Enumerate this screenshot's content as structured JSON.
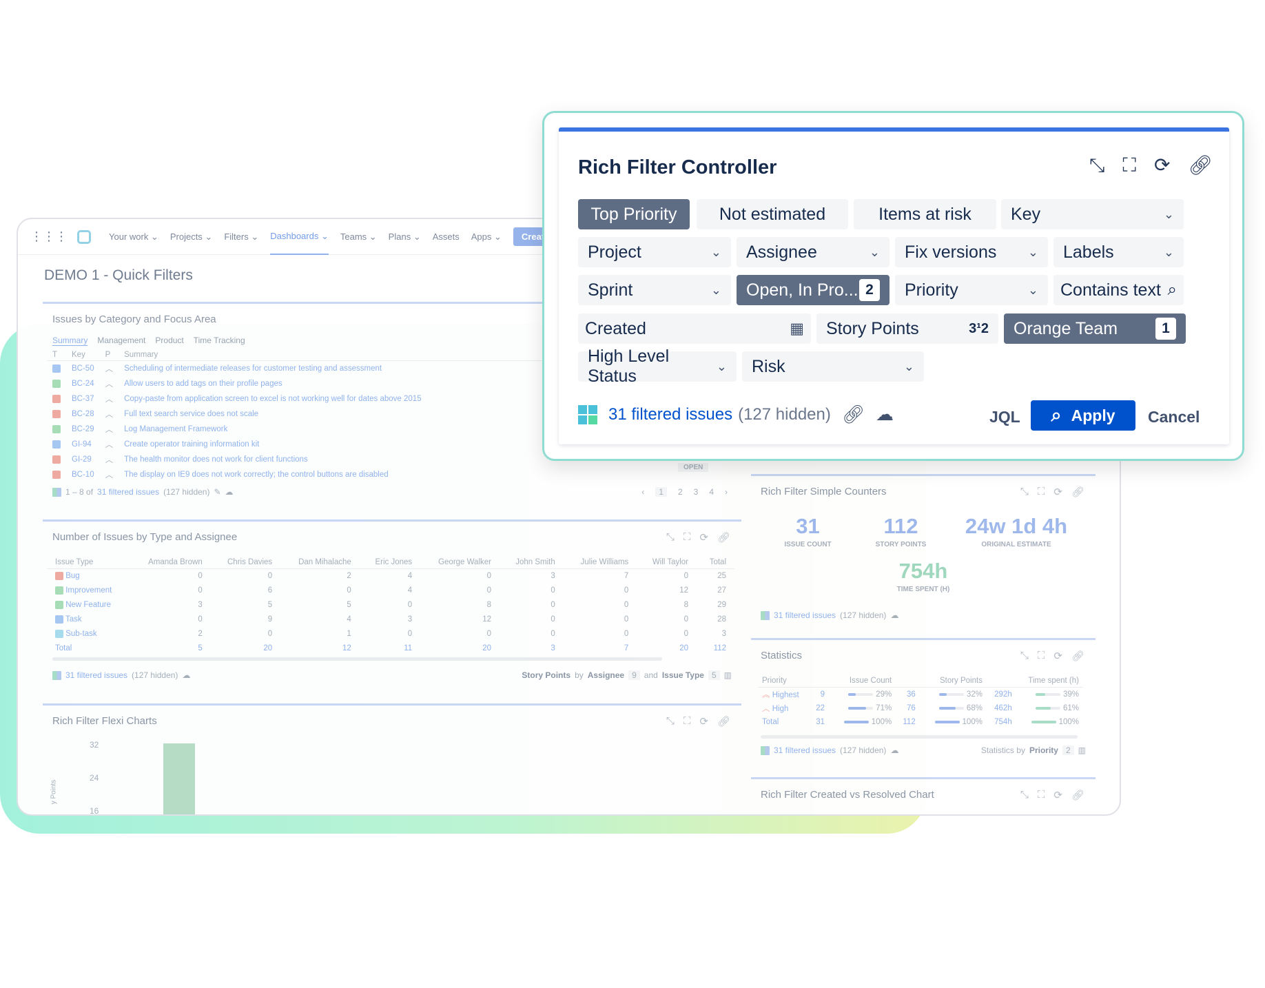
{
  "nav": {
    "items": [
      "Your work",
      "Projects",
      "Filters",
      "Dashboards",
      "Teams",
      "Plans",
      "Assets",
      "Apps"
    ],
    "active": "Dashboards",
    "create_label": "Create"
  },
  "dashboard": {
    "title": "DEMO 1 - Quick Filters"
  },
  "issues_gadget": {
    "title": "Issues by Category and Focus Area",
    "tabs": [
      "Summary",
      "Management",
      "Product",
      "Time Tracking"
    ],
    "columns": [
      "T",
      "Key",
      "P",
      "Summary"
    ],
    "rows": [
      {
        "type": "blue",
        "key": "BC-50",
        "summary": "Scheduling of intermediate releases for customer testing and assessment"
      },
      {
        "type": "green",
        "key": "BC-24",
        "summary": "Allow users to add tags on their profile pages"
      },
      {
        "type": "red",
        "key": "BC-37",
        "summary": "Copy-paste from application screen to excel is not working well for dates above 2015"
      },
      {
        "type": "red",
        "key": "BC-28",
        "summary": "Full text search service does not scale"
      },
      {
        "type": "green",
        "key": "BC-29",
        "summary": "Log Management Framework"
      },
      {
        "type": "blue",
        "key": "GI-94",
        "summary": "Create operator training information kit"
      },
      {
        "type": "red",
        "key": "GI-29",
        "summary": "The health monitor does not work for client functions"
      },
      {
        "type": "red",
        "key": "BC-10",
        "summary": "The display on IE9 does not work correctly; the control buttons are disabled"
      }
    ],
    "status_badge": "OPEN",
    "footer_range": "1 – 8 of",
    "footer_link": "31 filtered issues",
    "footer_hidden": "(127 hidden)",
    "pages": [
      "1",
      "2",
      "3",
      "4"
    ]
  },
  "type_gadget": {
    "title": "Number of Issues by Type and Assignee",
    "columns": [
      "Issue Type",
      "Amanda Brown",
      "Chris Davies",
      "Dan Mihalache",
      "Eric Jones",
      "George Walker",
      "John Smith",
      "Julie Williams",
      "Will Taylor",
      "Total"
    ],
    "rows": [
      {
        "type": "red",
        "name": "Bug",
        "values": [
          "0",
          "0",
          "2",
          "4",
          "0",
          "3",
          "7",
          "0",
          "25"
        ]
      },
      {
        "type": "green",
        "name": "Improvement",
        "values": [
          "0",
          "6",
          "0",
          "4",
          "0",
          "0",
          "0",
          "12",
          "27"
        ]
      },
      {
        "type": "green",
        "name": "New Feature",
        "values": [
          "3",
          "5",
          "5",
          "0",
          "8",
          "0",
          "0",
          "8",
          "29"
        ]
      },
      {
        "type": "blue",
        "name": "Task",
        "values": [
          "0",
          "9",
          "4",
          "3",
          "12",
          "0",
          "0",
          "0",
          "28"
        ]
      },
      {
        "type": "cyan",
        "name": "Sub-task",
        "values": [
          "2",
          "0",
          "1",
          "0",
          "0",
          "0",
          "0",
          "0",
          "3"
        ]
      }
    ],
    "total": {
      "name": "Total",
      "values": [
        "5",
        "20",
        "12",
        "11",
        "20",
        "3",
        "7",
        "20",
        "112"
      ]
    },
    "footer_link": "31 filtered issues",
    "footer_hidden": "(127 hidden)",
    "summary": {
      "metric": "Story Points",
      "by": "by",
      "dim1": "Assignee",
      "n1": "9",
      "and": "and",
      "dim2": "Issue Type",
      "n2": "5"
    }
  },
  "flexi_gadget": {
    "title": "Rich Filter Flexi Charts",
    "y_ticks": [
      "32",
      "24",
      "16"
    ],
    "y_label": "y Points",
    "chart_data": {
      "type": "bar",
      "ylim": [
        16,
        32
      ],
      "values": [
        32
      ]
    }
  },
  "counters_gadget": {
    "title": "Rich Filter Simple Counters",
    "counters": [
      {
        "value": "31",
        "label": "ISSUE COUNT"
      },
      {
        "value": "112",
        "label": "STORY POINTS"
      },
      {
        "value": "24w 1d 4h",
        "label": "ORIGINAL ESTIMATE"
      },
      {
        "value": "754h",
        "label": "TIME SPENT (H)"
      }
    ],
    "footer_link": "31 filtered issues",
    "footer_hidden": "(127 hidden)"
  },
  "stats_gadget": {
    "title": "Statistics",
    "columns": [
      "Priority",
      "Issue Count",
      "Story Points",
      "Time spent (h)"
    ],
    "rows": [
      {
        "name": "Highest",
        "count": "9",
        "count_pct": "29%",
        "count_frac": 0.29,
        "sp": "36",
        "sp_pct": "32%",
        "sp_frac": 0.32,
        "time": "292h",
        "time_pct": "39%",
        "time_frac": 0.39
      },
      {
        "name": "High",
        "count": "22",
        "count_pct": "71%",
        "count_frac": 0.71,
        "sp": "76",
        "sp_pct": "68%",
        "sp_frac": 0.68,
        "time": "462h",
        "time_pct": "61%",
        "time_frac": 0.61
      },
      {
        "name": "Total",
        "count": "31",
        "count_pct": "100%",
        "count_frac": 1,
        "sp": "112",
        "sp_pct": "100%",
        "sp_frac": 1,
        "time": "754h",
        "time_pct": "100%",
        "time_frac": 1
      }
    ],
    "footer_link": "31 filtered issues",
    "footer_hidden": "(127 hidden)",
    "summary": {
      "label": "Statistics by",
      "dim": "Priority",
      "n": "2"
    }
  },
  "created_gadget": {
    "title": "Rich Filter Created vs Resolved Chart"
  },
  "controller": {
    "title": "Rich Filter Controller",
    "row1": {
      "top_priority": "Top Priority",
      "not_estimated": "Not estimated",
      "items_at_risk": "Items at risk",
      "key": "Key"
    },
    "row2": {
      "project": "Project",
      "assignee": "Assignee",
      "fix_versions": "Fix versions",
      "labels": "Labels"
    },
    "row3": {
      "sprint": "Sprint",
      "status": "Open, In Pro...",
      "status_count": "2",
      "priority": "Priority",
      "contains_text": "Contains text"
    },
    "row4": {
      "created": "Created",
      "story_points": "Story Points",
      "team": "Orange Team",
      "team_count": "1"
    },
    "row5": {
      "high_level_status": "High Level Status",
      "risk": "Risk"
    },
    "footer": {
      "link": "31 filtered issues",
      "hidden": "(127 hidden)"
    },
    "jql": "JQL",
    "apply": "Apply",
    "cancel": "Cancel"
  }
}
